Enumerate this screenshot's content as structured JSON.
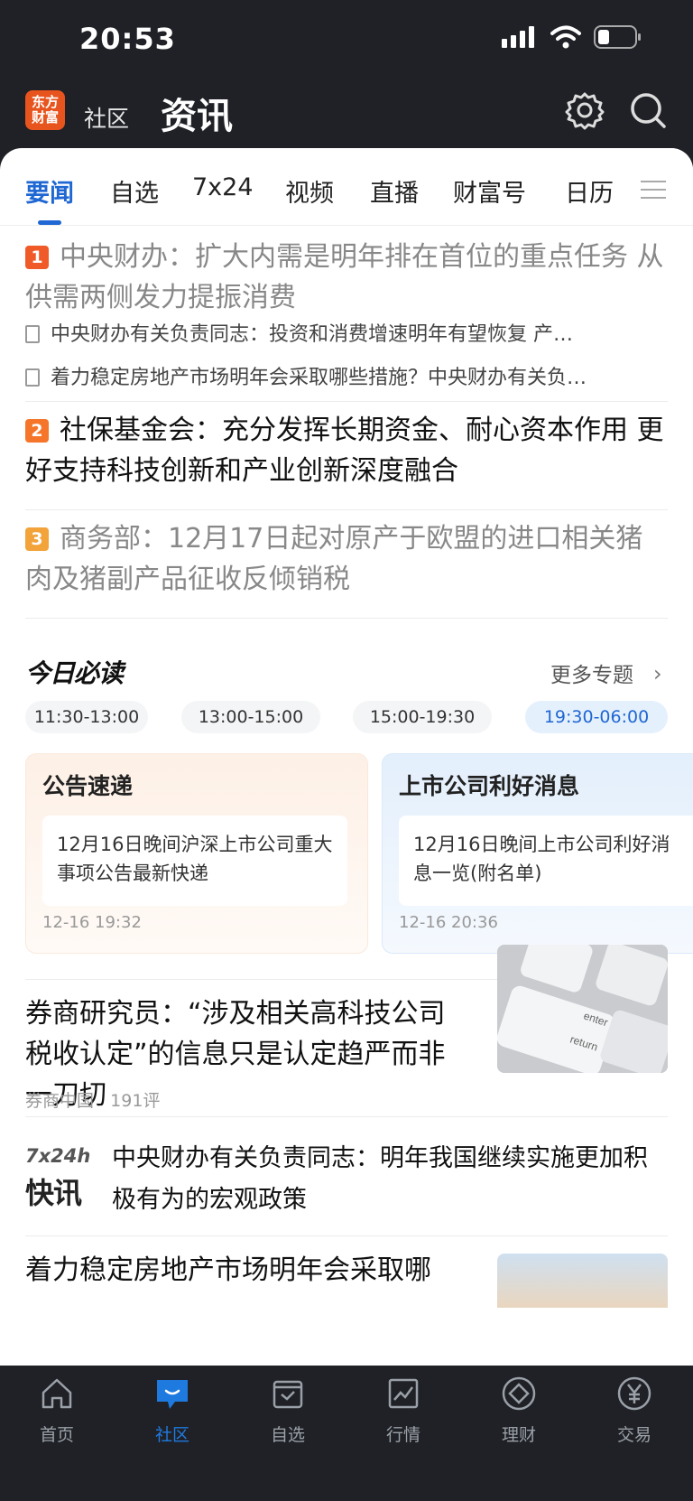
{
  "status_bar": {
    "time": "20:53"
  },
  "header": {
    "logo_text": "东方财富",
    "section": "社区",
    "title": "资讯"
  },
  "tabs": [
    "要闻",
    "自选",
    "7x24",
    "视频",
    "直播",
    "财富号",
    "日历"
  ],
  "headlines": [
    {
      "rank": "1",
      "title": "中央财办：扩大内需是明年排在首位的重点任务 从供需两侧发力提振消费",
      "subs": [
        "中央财办有关负责同志：投资和消费增速明年有望恢复 产…",
        "着力稳定房地产市场明年会采取哪些措施？中央财办有关负…"
      ]
    },
    {
      "rank": "2",
      "title": "社保基金会：充分发挥长期资金、耐心资本作用 更好支持科技创新和产业创新深度融合"
    },
    {
      "rank": "3",
      "title": "商务部：12月17日起对原产于欧盟的进口相关猪肉及猪副产品征收反倾销税"
    }
  ],
  "must_read": {
    "title": "今日必读",
    "more": "更多专题",
    "slots": [
      "11:30-13:00",
      "13:00-15:00",
      "15:00-19:30",
      "19:30-06:00"
    ],
    "active_slot": 3,
    "cards": [
      {
        "title": "公告速递",
        "body": "12月16日晚间沪深上市公司重大事项公告最新快递",
        "time": "12-16 19:32"
      },
      {
        "title": "上市公司利好消息",
        "body": "12月16日晚间上市公司利好消息一览(附名单)",
        "time": "12-16 20:36"
      }
    ]
  },
  "articles": [
    {
      "title": "券商研究员：“涉及相关高科技公司税收认定”的信息只是认定趋严而非一刀切",
      "source": "券商中国",
      "comments": "191评"
    },
    {
      "title": "着力稳定房地产市场明年会采取哪"
    }
  ],
  "flash": {
    "tag": "7x24h",
    "logo": "快讯",
    "title": "中央财办有关负责同志：明年我国继续实施更加积极有为的宏观政策"
  },
  "bottom_nav": [
    "首页",
    "社区",
    "自选",
    "行情",
    "理财",
    "交易"
  ],
  "colors": {
    "accent": "#1f67d2",
    "rank1": "#f05a28",
    "rank2": "#f5762a",
    "rank3": "#f2a33a",
    "header_bg": "#1f2126"
  }
}
